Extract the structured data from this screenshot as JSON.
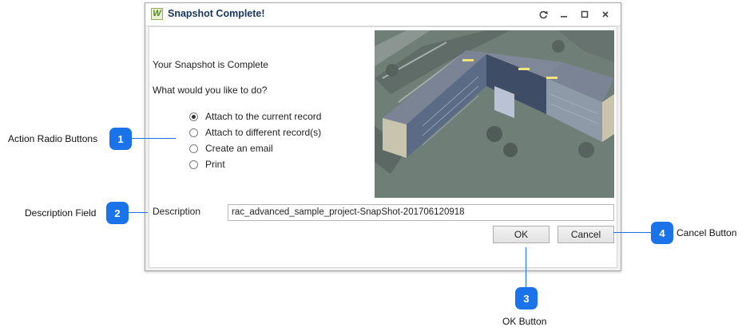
{
  "window": {
    "title": "Snapshot Complete!",
    "logo_letter": "W"
  },
  "content": {
    "heading": "Your Snapshot is Complete",
    "question": "What would you like to do?",
    "options": [
      {
        "label": "Attach to the current record",
        "selected": true
      },
      {
        "label": "Attach to different record(s)",
        "selected": false
      },
      {
        "label": "Create an email",
        "selected": false
      },
      {
        "label": "Print",
        "selected": false
      }
    ],
    "description_label": "Description",
    "description_value": "rac_advanced_sample_project-SnapShot-201706120918",
    "ok_label": "OK",
    "cancel_label": "Cancel"
  },
  "annotations": {
    "action_radio_buttons": {
      "number": "1",
      "label": "Action Radio Buttons"
    },
    "description_field": {
      "number": "2",
      "label": "Description Field"
    },
    "ok_button": {
      "number": "3",
      "label": "OK Button"
    },
    "cancel_button": {
      "number": "4",
      "label": "Cancel Button"
    }
  },
  "colors": {
    "accent": "#1a73e8",
    "title_text": "#17365d"
  }
}
